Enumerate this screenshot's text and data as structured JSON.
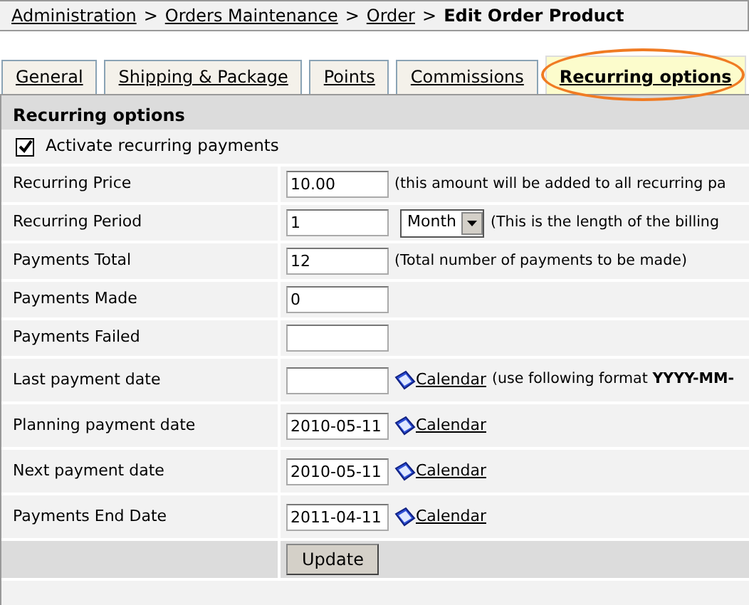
{
  "breadcrumb": {
    "links": [
      "Administration",
      "Orders Maintenance",
      "Order"
    ],
    "separator": ">",
    "current": "Edit Order Product"
  },
  "tabs": [
    {
      "label": "General",
      "selected": false,
      "highlighted": false
    },
    {
      "label": "Shipping & Package",
      "selected": false,
      "highlighted": false
    },
    {
      "label": "Points",
      "selected": false,
      "highlighted": false
    },
    {
      "label": "Commissions",
      "selected": false,
      "highlighted": false
    },
    {
      "label": "Recurring options",
      "selected": true,
      "highlighted": true
    }
  ],
  "panel": {
    "title": "Recurring options",
    "activate": {
      "label": "Activate recurring payments",
      "checked": true
    },
    "fields": [
      {
        "kind": "text",
        "label": "Recurring Price",
        "value": "10.00",
        "hint": "(this amount will be added to all recurring pa"
      },
      {
        "kind": "select",
        "label": "Recurring Period",
        "value": "1",
        "unit": "Month",
        "hint": "(This is the length of the billing"
      },
      {
        "kind": "text",
        "label": "Payments Total",
        "value": "12",
        "hint": "(Total number of payments to be made)"
      },
      {
        "kind": "text",
        "label": "Payments Made",
        "value": "0"
      },
      {
        "kind": "text",
        "label": "Payments Failed"
      },
      {
        "kind": "date",
        "label": "Last payment date",
        "link": "Calendar",
        "hint": "(use following format **YYYY-MM-**"
      },
      {
        "kind": "date",
        "label": "Planning payment date",
        "value": "2010-05-11",
        "link": "Calendar"
      },
      {
        "kind": "date",
        "label": "Next payment date",
        "value": "2010-05-11",
        "link": "Calendar"
      },
      {
        "kind": "date",
        "label": "Payments End Date",
        "value": "2011-04-11",
        "link": "Calendar"
      }
    ],
    "submit": "Update"
  }
}
